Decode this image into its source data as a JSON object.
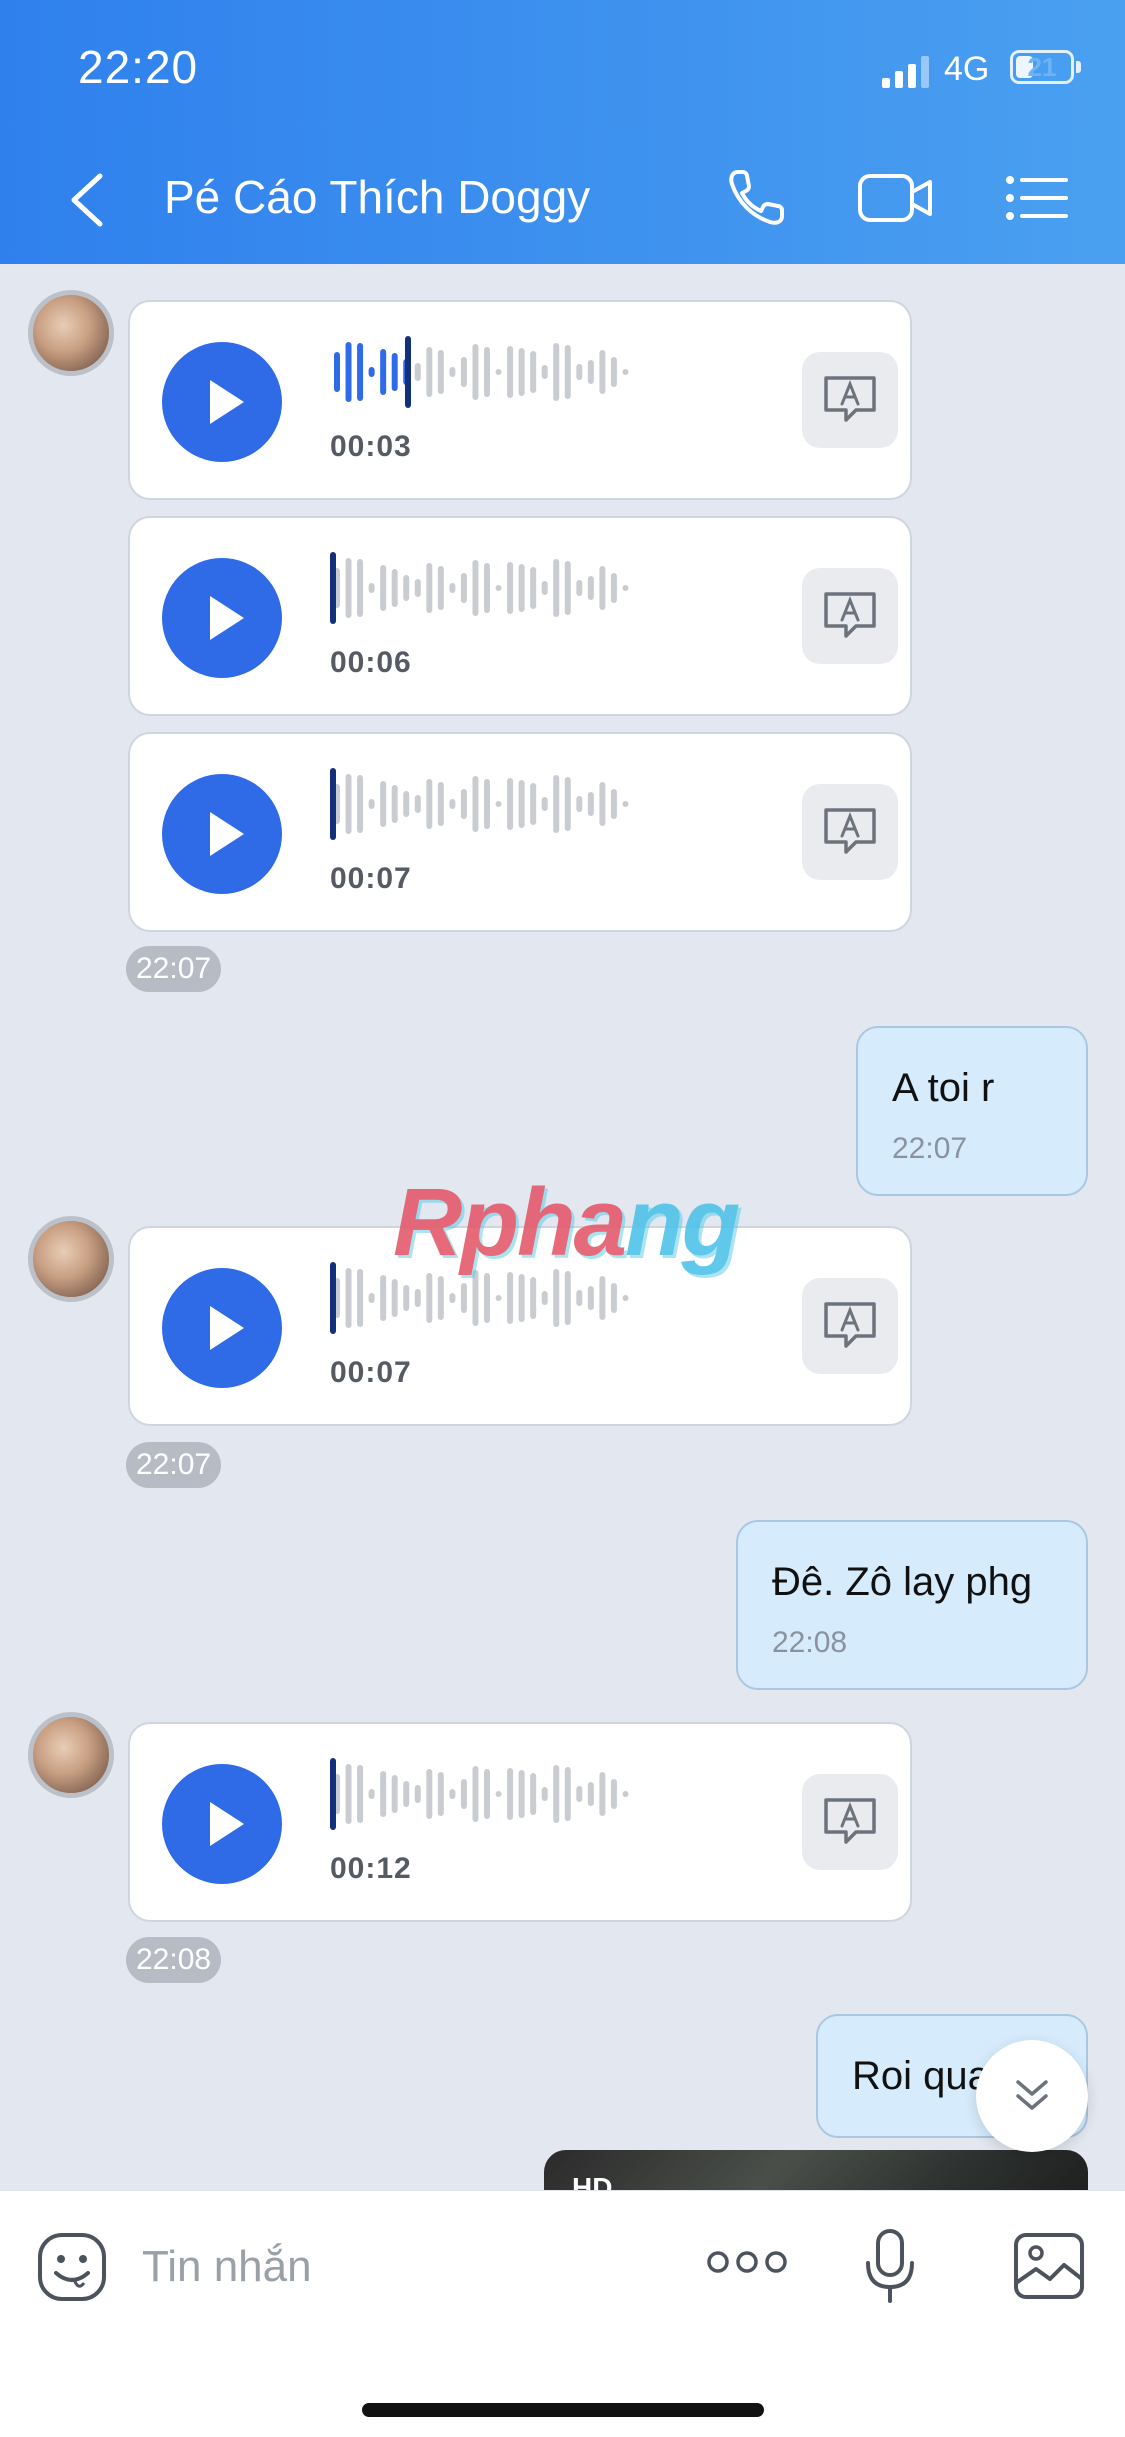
{
  "status_bar": {
    "time": "22:20",
    "network": "4G",
    "battery": "21"
  },
  "header": {
    "title": "Pé Cáo Thích Doggy"
  },
  "icons": {
    "back": "chevron-left-icon",
    "call": "phone-icon",
    "video": "video-camera-icon",
    "menu": "list-menu-icon",
    "play": "play-icon",
    "transcribe": "speech-to-text-icon",
    "sticker": "sticker-face-icon",
    "more": "more-dots-icon",
    "mic": "microphone-icon",
    "gallery": "image-gallery-icon",
    "scroll_down": "double-chevron-down-icon"
  },
  "colors": {
    "accent": "#2f6be6",
    "header": "#3b8def",
    "outgoing_bubble": "#d6ecfd",
    "background": "#e3e8f0"
  },
  "messages": {
    "voice1": {
      "duration": "00:03",
      "progress": 0.25
    },
    "voice2": {
      "duration": "00:06",
      "progress": 0
    },
    "voice3": {
      "duration": "00:07",
      "progress": 0
    },
    "time1": "22:07",
    "out1": {
      "text": "A toi r",
      "time": "22:07"
    },
    "voice4": {
      "duration": "00:07",
      "progress": 0
    },
    "time2": "22:07",
    "out2": {
      "text": "Đê. Zô lay phg",
      "time": "22:08"
    },
    "voice5": {
      "duration": "00:12",
      "progress": 0
    },
    "time3": "22:08",
    "out3": {
      "text": "Roi qua"
    },
    "image_badge": "HD"
  },
  "watermark": {
    "part1": "Rpha",
    "part2": "ng"
  },
  "composer": {
    "placeholder": "Tin nhắn"
  }
}
